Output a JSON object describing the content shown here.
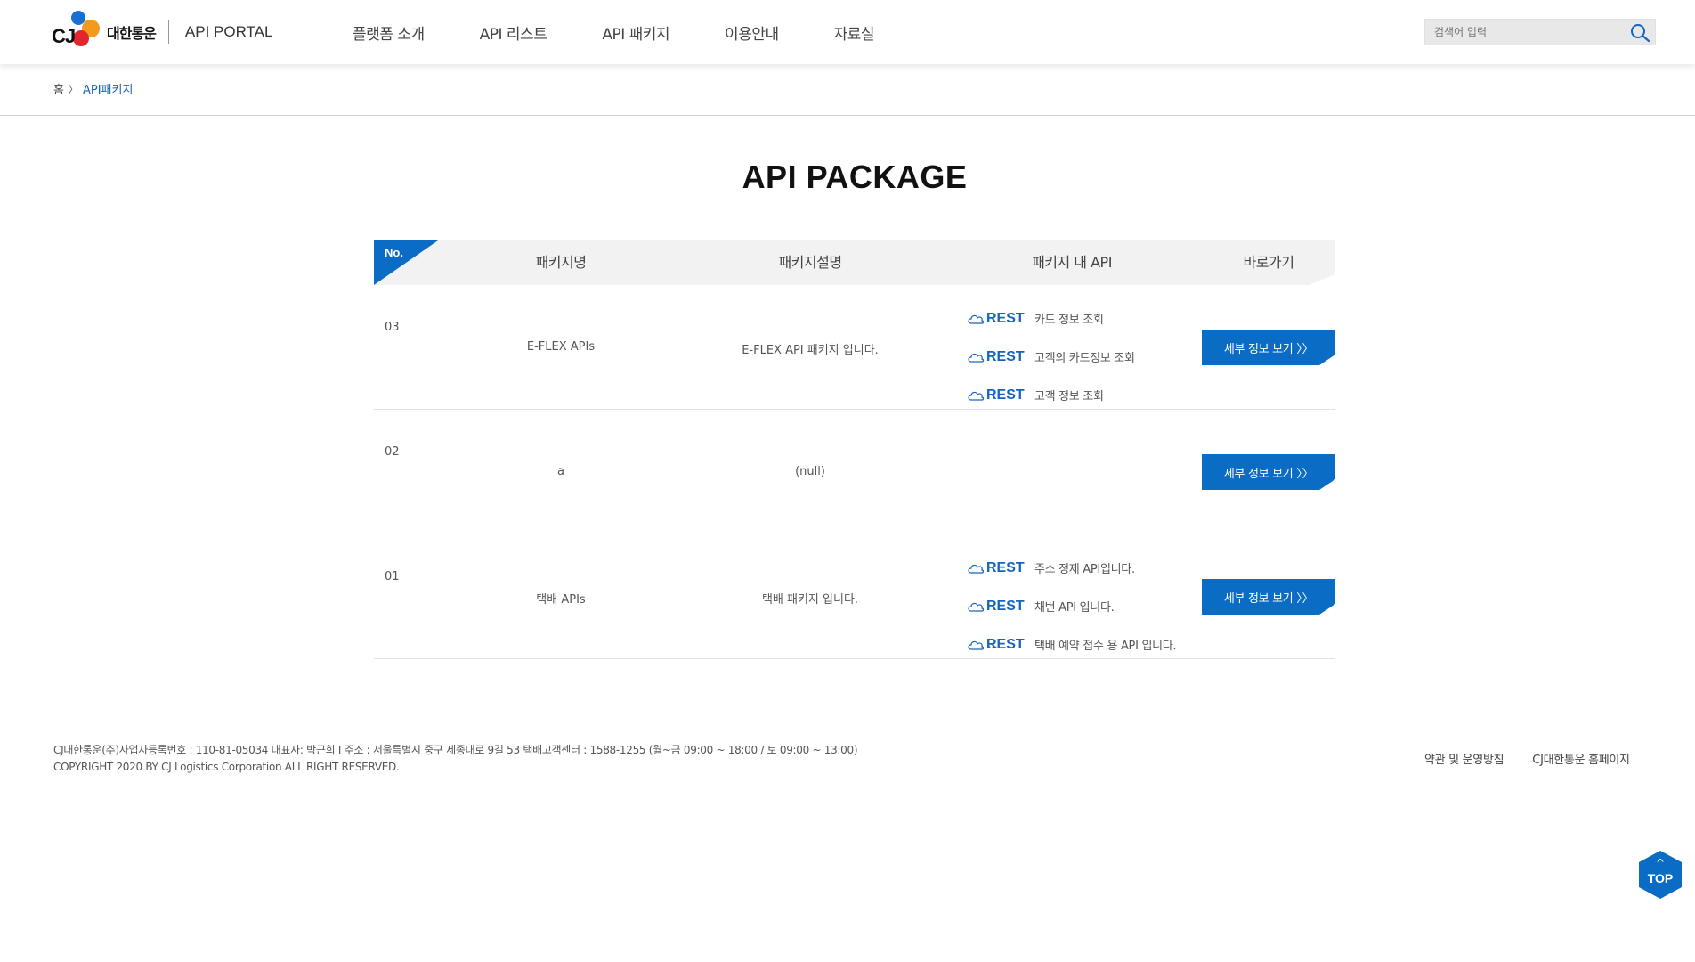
{
  "header": {
    "logo": {
      "cj": "CJ",
      "corp": "대한통운",
      "portal": "API PORTAL"
    },
    "nav": [
      "플랫폼 소개",
      "API 리스트",
      "API 패키지",
      "이용안내",
      "자료실"
    ],
    "search": {
      "placeholder": "검색어 입력"
    }
  },
  "breadcrumb": {
    "home": "홈",
    "separator": "〉",
    "current": "API패키지"
  },
  "page_title": "API PACKAGE",
  "table": {
    "headers": {
      "no": "No.",
      "name": "패키지명",
      "desc": "패키지설명",
      "apis": "패키지 내 API",
      "go": "바로가기"
    },
    "rows": [
      {
        "no": "03",
        "name": "E-FLEX APIs",
        "desc": "E-FLEX API 패키지 입니다.",
        "apis": [
          {
            "type": "REST",
            "name": "카드 정보 조회"
          },
          {
            "type": "REST",
            "name": "고객의 카드정보 조회"
          },
          {
            "type": "REST",
            "name": "고객 정보 조회"
          }
        ],
        "more": "",
        "button": "세부 정보 보기 〉〉"
      },
      {
        "no": "02",
        "name": "a",
        "desc": "(null)",
        "apis": [],
        "more": "",
        "button": "세부 정보 보기 〉〉"
      },
      {
        "no": "01",
        "name": "택배 APIs",
        "desc": "택배 패키지 입니다.",
        "apis": [
          {
            "type": "REST",
            "name": "주소 정제 API입니다."
          },
          {
            "type": "REST",
            "name": "채번 API 입니다."
          },
          {
            "type": "REST",
            "name": "택배 예약 접수 용 API 입니다."
          }
        ],
        "more": "...",
        "button": "세부 정보 보기 〉〉"
      }
    ]
  },
  "footer": {
    "info_line1": "CJ대한통운(주)사업자등록번호 : 110-81-05034 대표자: 박근희 I 주소 : 서울특별시 중구 세종대로 9길 53 택배고객센터 : 1588-1255 (월~금 09:00 ~ 18:00 / 토 09:00 ~ 13:00)",
    "info_line2": "COPYRIGHT 2020 BY CJ Logistics Corporation ALL RIGHT RESERVED.",
    "links": [
      "약관 및 운영방침",
      "CJ대한통운 홈페이지"
    ]
  },
  "top_button": {
    "label": "TOP",
    "arrow": "^"
  },
  "colors": {
    "accent": "#0a6cc4",
    "link": "#1565c0",
    "header_bg": "#f2f2f2"
  }
}
